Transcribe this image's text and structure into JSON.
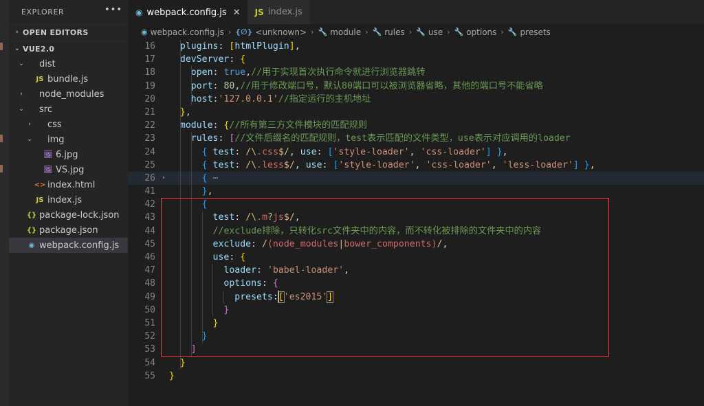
{
  "sidebar": {
    "header": {
      "title": "EXPLORER",
      "more_icon": "ellipsis-icon"
    },
    "open_editors": {
      "label": "OPEN EDITORS",
      "twisty": "›",
      "expanded": false
    },
    "workspace": {
      "label": "VUE2.0",
      "twisty": "⌄",
      "expanded": true
    },
    "tree": [
      {
        "label": "dist",
        "chev": "⌄",
        "icon": "",
        "icon_class": "",
        "indent": 12,
        "selected": false
      },
      {
        "label": "bundle.js",
        "chev": "",
        "icon": "JS",
        "icon_class": "ic-js",
        "indent": 24,
        "selected": false
      },
      {
        "label": "node_modules",
        "chev": "›",
        "icon": "",
        "icon_class": "",
        "indent": 12,
        "selected": false
      },
      {
        "label": "src",
        "chev": "⌄",
        "icon": "",
        "icon_class": "",
        "indent": 12,
        "selected": false
      },
      {
        "label": "css",
        "chev": "›",
        "icon": "",
        "icon_class": "",
        "indent": 24,
        "selected": false
      },
      {
        "label": "img",
        "chev": "⌄",
        "icon": "",
        "icon_class": "",
        "indent": 24,
        "selected": false
      },
      {
        "label": "6.jpg",
        "chev": "",
        "icon": "🖼",
        "icon_class": "ic-img",
        "indent": 36,
        "selected": false
      },
      {
        "label": "VS.jpg",
        "chev": "",
        "icon": "🖼",
        "icon_class": "ic-img",
        "indent": 36,
        "selected": false
      },
      {
        "label": "index.html",
        "chev": "",
        "icon": "<>",
        "icon_class": "ic-html",
        "indent": 24,
        "selected": false
      },
      {
        "label": "index.js",
        "chev": "",
        "icon": "JS",
        "icon_class": "ic-js",
        "indent": 24,
        "selected": false
      },
      {
        "label": "package-lock.json",
        "chev": "",
        "icon": "{}",
        "icon_class": "ic-json",
        "indent": 12,
        "selected": false
      },
      {
        "label": "package.json",
        "chev": "",
        "icon": "{}",
        "icon_class": "ic-json",
        "indent": 12,
        "selected": false
      },
      {
        "label": "webpack.config.js",
        "chev": "",
        "icon": "◉",
        "icon_class": "ic-webpack",
        "indent": 12,
        "selected": true
      }
    ]
  },
  "tabs": [
    {
      "label": "webpack.config.js",
      "icon": "◉",
      "icon_class": "ic-webpack",
      "active": true,
      "close_icon": "✕"
    },
    {
      "label": "index.js",
      "icon": "JS",
      "icon_class": "ic-js",
      "active": false,
      "close_icon": ""
    }
  ],
  "breadcrumb": [
    {
      "label": "webpack.config.js",
      "icon": "◉",
      "icon_class": "ic-webpack"
    },
    {
      "label": "<unknown>",
      "icon": "{∅}",
      "icon_class": "ic-brace"
    },
    {
      "label": "module",
      "icon": "🔧",
      "icon_class": "ic-wrench"
    },
    {
      "label": "rules",
      "icon": "🔧",
      "icon_class": "ic-wrench"
    },
    {
      "label": "use",
      "icon": "🔧",
      "icon_class": "ic-wrench"
    },
    {
      "label": "options",
      "icon": "🔧",
      "icon_class": "ic-wrench"
    },
    {
      "label": "presets",
      "icon": "🔧",
      "icon_class": "ic-wrench"
    }
  ],
  "breadcrumb_separator": "›",
  "editor": {
    "language": "javascript",
    "cursor_line": 49,
    "folded_line": 26,
    "fold_chevron": "›",
    "annotation_color": "#fb3b3b",
    "lines": [
      {
        "n": "16",
        "text": "  plugins: [htmlPlugin],"
      },
      {
        "n": "17",
        "text": "  devServer: {"
      },
      {
        "n": "18",
        "text": "    open: true,//用于实现首次执行命令就进行浏览器跳转"
      },
      {
        "n": "19",
        "text": "    port: 80,//用于修改端口号，默认80端口可以被浏览器省略，其他的端口号不能省略"
      },
      {
        "n": "20",
        "text": "    host:'127.0.0.1'//指定运行的主机地址"
      },
      {
        "n": "21",
        "text": "  },"
      },
      {
        "n": "22",
        "text": "  module: {//所有第三方文件模块的匹配规则"
      },
      {
        "n": "23",
        "text": "    rules: [//文件后缀名的匹配规则，test表示匹配的文件类型，use表示对应调用的loader"
      },
      {
        "n": "24",
        "text": "      { test: /\\.css$/, use: ['style-loader', 'css-loader'] },"
      },
      {
        "n": "25",
        "text": "      { test: /\\.less$/, use: ['style-loader', 'css-loader', 'less-loader'] },"
      },
      {
        "n": "26",
        "text": "      { ⋯"
      },
      {
        "n": "41",
        "text": "      },"
      },
      {
        "n": "42",
        "text": "      {"
      },
      {
        "n": "43",
        "text": "        test: /\\.m?js$/,"
      },
      {
        "n": "44",
        "text": "        //exclude排除，只转化src文件夹中的内容，而不转化被排除的文件夹中的内容"
      },
      {
        "n": "45",
        "text": "        exclude: /(node_modules|bower_components)/,"
      },
      {
        "n": "46",
        "text": "        use: {"
      },
      {
        "n": "47",
        "text": "          loader: 'babel-loader',"
      },
      {
        "n": "48",
        "text": "          options: {"
      },
      {
        "n": "49",
        "text": "            presets:['es2015']"
      },
      {
        "n": "50",
        "text": "          }"
      },
      {
        "n": "51",
        "text": "        }"
      },
      {
        "n": "52",
        "text": "      }"
      },
      {
        "n": "53",
        "text": "    ]"
      },
      {
        "n": "54",
        "text": "  }"
      },
      {
        "n": "55",
        "text": "}"
      }
    ]
  }
}
